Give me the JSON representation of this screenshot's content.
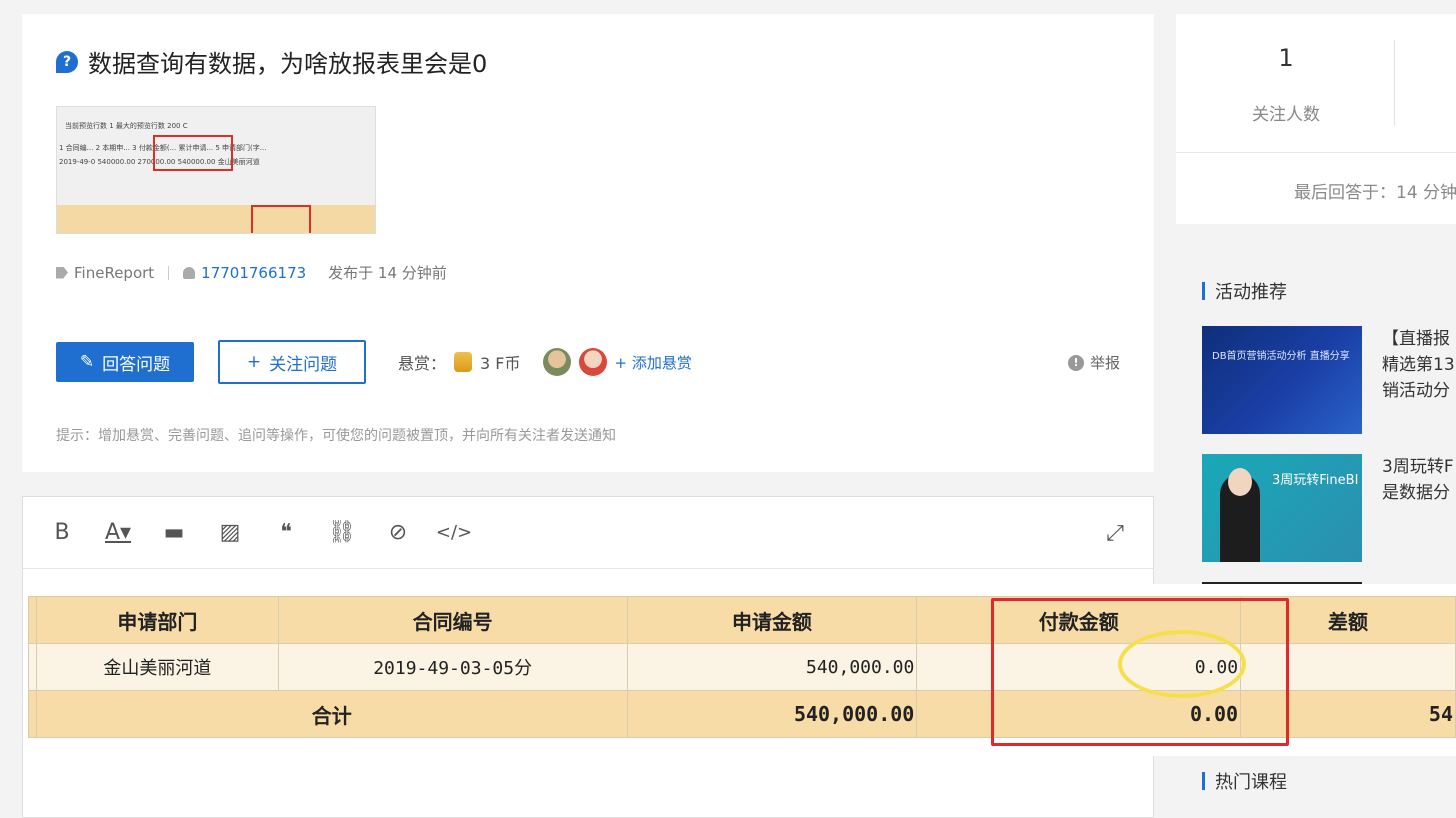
{
  "question": {
    "icon": "question-icon",
    "title": "数据查询有数据，为啥放报表里会是0",
    "thumbnail": {
      "rows": [
        "当前预览行数  1     最大的预览行数  200   C",
        "1 合同编... 2 本期申... 3 付款金额(... 累计申请... 5 申请部门(字...",
        "2019-49-0  540000.00  270000.00  540000.00  金山美丽河道"
      ]
    },
    "tag": "FineReport",
    "author": "17701766173",
    "posted": "发布于 14 分钟前",
    "answer_button": "回答问题",
    "follow_button": "关注问题",
    "reward_label": "悬赏：",
    "reward_amount": "3 F币",
    "add_reward": "+ 添加悬赏",
    "report": "举报",
    "hint": "提示：增加悬赏、完善问题、追问等操作，可使您的问题被置顶，并向所有关注者发送通知"
  },
  "editor": {
    "tools": [
      {
        "glyph": "B",
        "name": "bold-icon"
      },
      {
        "glyph": "A▾",
        "name": "font-color-icon"
      },
      {
        "glyph": "▬",
        "name": "insert-icon"
      },
      {
        "glyph": "▨",
        "name": "image-icon"
      },
      {
        "glyph": "❝",
        "name": "quote-icon"
      },
      {
        "glyph": "⛓",
        "name": "link-icon"
      },
      {
        "glyph": "⊘",
        "name": "attachment-icon"
      },
      {
        "glyph": "</>",
        "name": "code-icon"
      }
    ],
    "expand_glyph": "⤢"
  },
  "sidebar": {
    "follow_count": "1",
    "follow_label": "关注人数",
    "last_answer": "最后回答于：14 分钟",
    "activity_title": "活动推荐",
    "activities": [
      {
        "line1": "【直播报",
        "line2": "精选第13",
        "line3": "销活动分",
        "image_caption": "DB首页营销活动分析 直播分享"
      },
      {
        "line1": "3周玩转F",
        "line2": "是数据分",
        "line3": "",
        "image_caption": "3周玩转FineBI"
      }
    ],
    "courses_title": "热门课程"
  },
  "overlay_table": {
    "headers": [
      "申请部门",
      "合同编号",
      "申请金额",
      "付款金额",
      "差额"
    ],
    "row": [
      "金山美丽河道",
      "2019-49-03-05分",
      "540,000.00",
      "0.00",
      ""
    ],
    "summary_label": "合计",
    "summary": [
      "540,000.00",
      "0.00",
      "54"
    ]
  }
}
